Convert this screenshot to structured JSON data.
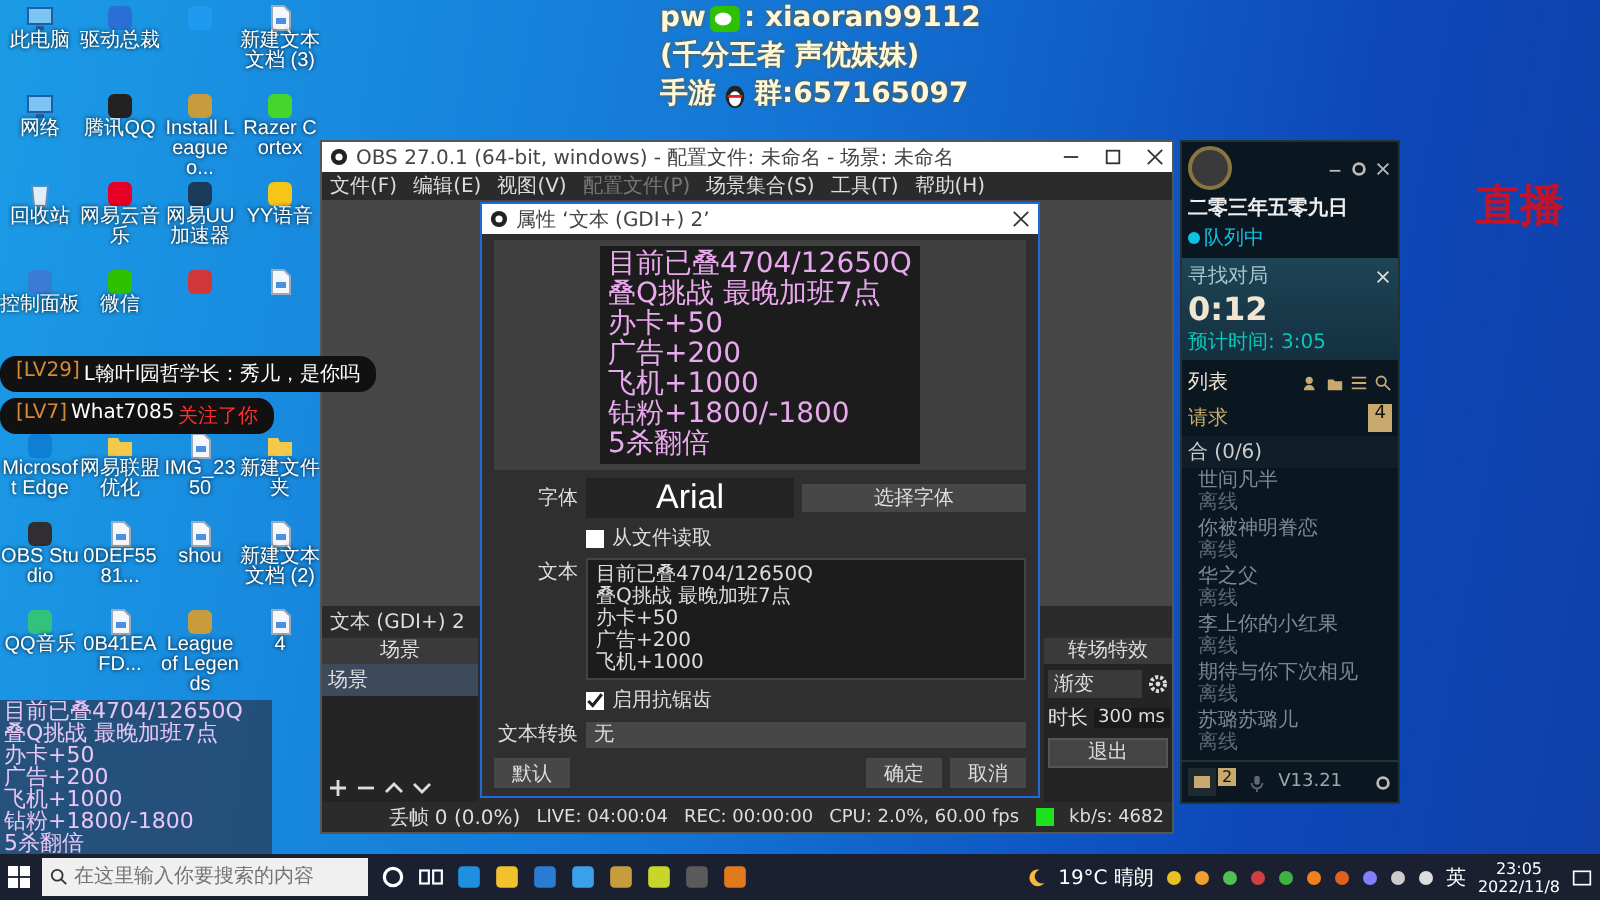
{
  "stream_caption": {
    "wechat_prefix": "pw",
    "wechat_id": ": xiaoran99112",
    "tagline": "(千分王者 声优妹妹)",
    "group_prefix": "手游",
    "group_id": "群:657165097"
  },
  "live_mark": "直播",
  "desktop_icons_upper": [
    {
      "label": "此电脑",
      "kind": "pc"
    },
    {
      "label": "驱动总裁",
      "kind": "app",
      "color": "#2a6fd6"
    },
    {
      "kind": "app",
      "color": "#1e9bf0"
    },
    {
      "label": "新建文本文档 (3)",
      "kind": "file"
    },
    {
      "label": "网络",
      "kind": "pc"
    },
    {
      "label": "腾讯QQ",
      "kind": "app",
      "color": "#222222"
    },
    {
      "label": "Install League o...",
      "kind": "app",
      "color": "#c89b3c"
    },
    {
      "label": "Razer Cortex",
      "kind": "app",
      "color": "#44d62c"
    },
    {
      "label": "回收站",
      "kind": "bin"
    },
    {
      "label": "网易云音乐",
      "kind": "app",
      "color": "#e60026"
    },
    {
      "label": "网易UU加速器",
      "kind": "app",
      "color": "#1a3c5a"
    },
    {
      "label": "YY语音",
      "kind": "app",
      "color": "#f5c518"
    },
    {
      "label": "控制面板",
      "kind": "app",
      "color": "#3a7bd5"
    },
    {
      "label": "微信",
      "kind": "app",
      "color": "#2dc100"
    },
    {
      "kind": "app",
      "color": "#d13639"
    },
    {
      "kind": "file"
    }
  ],
  "desktop_icons_lower": [
    {
      "label": "Microsoft Edge",
      "kind": "app",
      "color": "#0f7fd6"
    },
    {
      "label": "网易联盟优化",
      "kind": "folder"
    },
    {
      "label": "IMG_2350",
      "kind": "file"
    },
    {
      "label": "新建文件夹",
      "kind": "folder"
    },
    {
      "label": "OBS Studio",
      "kind": "app",
      "color": "#302e31"
    },
    {
      "label": "0DEF5581...",
      "kind": "file"
    },
    {
      "label": "shou",
      "kind": "file"
    },
    {
      "label": "新建文本文档 (2)",
      "kind": "file"
    },
    {
      "label": "QQ音乐",
      "kind": "app",
      "color": "#31c27c"
    },
    {
      "label": "0B41EAFD...",
      "kind": "file"
    },
    {
      "label": "League of Legends",
      "kind": "app",
      "color": "#c89b3c"
    },
    {
      "label": "4",
      "kind": "file"
    }
  ],
  "chat_messages": [
    {
      "level": "[LV29]",
      "text": "L翰叶l园哲学长：秀儿，是你吗"
    },
    {
      "level": "[LV7]",
      "text": "What7085",
      "action": "关注了你"
    }
  ],
  "stats_overlay": [
    "目前已叠4704/12650Q",
    "叠Q挑战 最晚加班7点",
    "办卡+50",
    "广告+200",
    "飞机+1000",
    "钻粉+1800/-1800",
    "5杀翻倍"
  ],
  "obs": {
    "title": "OBS 27.0.1 (64-bit, windows) - 配置文件: 未命名 - 场景: 未命名",
    "menu": [
      {
        "label": "文件(F)",
        "disabled": false
      },
      {
        "label": "编辑(E)",
        "disabled": false
      },
      {
        "label": "视图(V)",
        "disabled": false
      },
      {
        "label": "配置文件(P)",
        "disabled": true
      },
      {
        "label": "场景集合(S)",
        "disabled": false
      },
      {
        "label": "工具(T)",
        "disabled": false
      },
      {
        "label": "帮助(H)",
        "disabled": false
      }
    ],
    "source_label": "文本 (GDI+) 2",
    "scenes": {
      "header": "场景",
      "items": [
        {
          "label": "场景",
          "selected": true
        }
      ]
    },
    "transitions": {
      "header": "转场特效",
      "type": "渐变",
      "duration_label": "时长",
      "duration": "300 ms",
      "exit": "退出"
    },
    "status": {
      "dropped": "丢帧 0 (0.0%)",
      "live": "LIVE: 04:00:04",
      "rec": "REC: 00:00:00",
      "cpu": "CPU: 2.0%, 60.00 fps",
      "bitrate": "kb/s: 4682"
    }
  },
  "properties_dialog": {
    "title": "属性 ‘文本 (GDI+) 2’",
    "preview_lines": [
      "目前已叠4704/12650Q",
      "叠Q挑战 最晚加班7点",
      "办卡+50",
      "广告+200",
      "飞机+1000",
      "钻粉+1800/-1800",
      "5杀翻倍"
    ],
    "font_label": "字体",
    "font_name": "Arial",
    "choose_font": "选择字体",
    "from_file": {
      "label": "从文件读取",
      "checked": false
    },
    "text_label": "文本",
    "text_lines": [
      "目前已叠4704/12650Q",
      "叠Q挑战 最晚加班7点",
      "办卡+50",
      "广告+200",
      "飞机+1000"
    ],
    "antialias": {
      "label": "启用抗锯齿",
      "checked": true
    },
    "transform_label": "文本转换",
    "transform_value": "无",
    "defaults": "默认",
    "ok": "确定",
    "cancel": "取消"
  },
  "game_client": {
    "name": "二零三年五零九日",
    "status": "队列中",
    "search_title": "寻找对局",
    "timer": "0:12",
    "estimate": "预计时间: 3:05",
    "list_title": "列表",
    "requests": "请求",
    "requests_count": "4",
    "group": "合 (0/6)",
    "friends": [
      {
        "name": "世间凡半",
        "status": "离线"
      },
      {
        "name": "你被神明眷恋",
        "status": "离线"
      },
      {
        "name": "华之父",
        "status": "离线"
      },
      {
        "name": "李上你的小红果",
        "status": "离线"
      },
      {
        "name": "期待与你下次相见",
        "status": "离线"
      },
      {
        "name": "苏璐苏璐儿",
        "status": "离线"
      }
    ],
    "chat_badge": "2",
    "version": "V13.21"
  },
  "taskbar": {
    "search_placeholder": "在这里输入你要搜索的内容",
    "apps": [
      {
        "color": "#1f8fe0"
      },
      {
        "color": "#f2c12e"
      },
      {
        "color": "#2a7bd4"
      },
      {
        "color": "#3aa0e8"
      },
      {
        "color": "#c89b3c"
      },
      {
        "color": "#c8d62a"
      },
      {
        "color": "#5a5a5a"
      },
      {
        "color": "#e07a1a"
      }
    ],
    "weather": "19°C 晴朗",
    "tray": [
      {
        "color": "#e8c020"
      },
      {
        "color": "#f0a030"
      },
      {
        "color": "#50c050"
      },
      {
        "color": "#d04040"
      },
      {
        "color": "#40b040"
      },
      {
        "color": "#f08020"
      },
      {
        "color": "#e06020"
      },
      {
        "color": "#8080ff"
      },
      {
        "color": "#cccccc"
      },
      {
        "color": "#dddddd"
      }
    ],
    "ime": "英",
    "time": "23:05",
    "date": "2022/11/8"
  }
}
